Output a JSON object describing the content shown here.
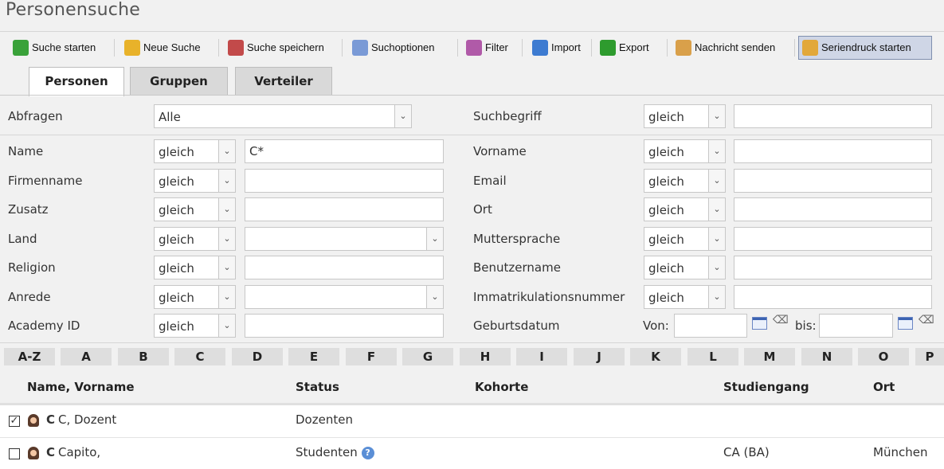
{
  "page": {
    "title": "Personensuche"
  },
  "toolbar": {
    "items": [
      {
        "label": "Suche starten",
        "icon": "search-icon",
        "color": "#3aa23a"
      },
      {
        "label": "Neue Suche",
        "icon": "new-search-icon",
        "color": "#e8b22a"
      },
      {
        "label": "Suche speichern",
        "icon": "save-search-icon",
        "color": "#c24a4a"
      },
      {
        "label": "Suchoptionen",
        "icon": "search-options-icon",
        "color": "#7a9ad6"
      },
      {
        "label": "Filter",
        "icon": "filter-icon",
        "color": "#b05aa8"
      },
      {
        "label": "Import",
        "icon": "import-icon",
        "color": "#3d7bd1"
      },
      {
        "label": "Export",
        "icon": "export-icon",
        "color": "#2e9b2e"
      },
      {
        "label": "Nachricht senden",
        "icon": "message-icon",
        "color": "#d9a04a"
      },
      {
        "label": "Seriendruck starten",
        "icon": "mail-merge-icon",
        "color": "#e2a83a"
      }
    ]
  },
  "tabs": [
    "Personen",
    "Gruppen",
    "Verteiler"
  ],
  "form": {
    "abfragen_label": "Abfragen",
    "abfragen_value": "Alle",
    "suchbegriff_label": "Suchbegriff",
    "operator": "gleich",
    "left": [
      {
        "label": "Name",
        "value": "C*"
      },
      {
        "label": "Firmenname",
        "value": ""
      },
      {
        "label": "Zusatz",
        "value": ""
      },
      {
        "label": "Land",
        "value": ""
      },
      {
        "label": "Religion",
        "value": ""
      },
      {
        "label": "Anrede",
        "value": ""
      },
      {
        "label": "Academy ID",
        "value": ""
      }
    ],
    "right": [
      {
        "label": "Vorname"
      },
      {
        "label": "Email"
      },
      {
        "label": "Ort"
      },
      {
        "label": "Muttersprache"
      },
      {
        "label": "Benutzername"
      },
      {
        "label": "Immatrikulationsnummer"
      }
    ],
    "geburtsdatum_label": "Geburtsdatum",
    "von_label": "Von:",
    "bis_label": "bis:"
  },
  "alphabet": [
    "A-Z",
    "A",
    "B",
    "C",
    "D",
    "E",
    "F",
    "G",
    "H",
    "I",
    "J",
    "K",
    "L",
    "M",
    "N",
    "O",
    "P"
  ],
  "table": {
    "headers": [
      "Name, Vorname",
      "Status",
      "Kohorte",
      "Studiengang",
      "Ort"
    ],
    "rows": [
      {
        "checked": true,
        "initial": "C",
        "name": "C, Dozent",
        "status": "Dozenten",
        "kohorte": "",
        "studiengang": "",
        "ort": ""
      },
      {
        "checked": false,
        "initial": "C",
        "name": "Capito,",
        "status": "Studenten",
        "kohorte": "",
        "studiengang": "CA (BA)",
        "ort": "München"
      }
    ]
  }
}
